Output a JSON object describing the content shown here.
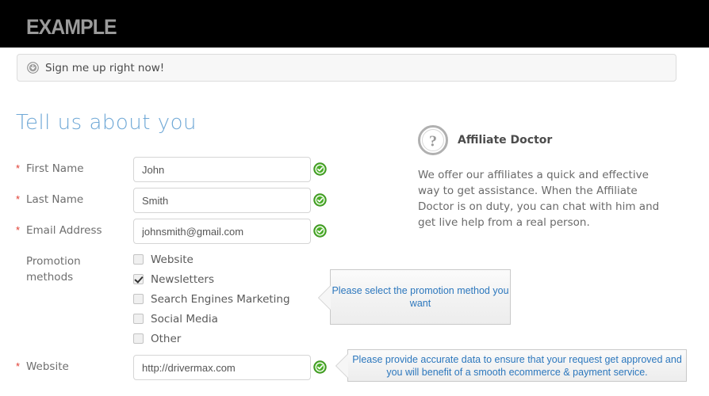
{
  "header": {
    "brand": "EXAMPLE",
    "brand_color": "#9b9b9b",
    "background_color": "#000000"
  },
  "signup_bar": {
    "label": "Sign me up right now!",
    "icon": "arrow-down-circle-icon"
  },
  "section": {
    "title": "Tell us about you",
    "title_color": "#6fa8d6"
  },
  "form": {
    "required_marker": "*",
    "fields": [
      {
        "label": "First Name",
        "value": "John",
        "required": true,
        "valid_icon": "green-check-icon"
      },
      {
        "label": "Last Name",
        "value": "Smith",
        "required": true,
        "valid_icon": "green-check-icon"
      },
      {
        "label": "Email Address",
        "value": "johnsmith@gmail.com",
        "required": true,
        "valid_icon": "green-check-icon"
      }
    ],
    "promotion": {
      "label": "Promotion methods",
      "options": [
        {
          "label": "Website",
          "checked": false
        },
        {
          "label": "Newsletters",
          "checked": true
        },
        {
          "label": "Search Engines Marketing",
          "checked": false
        },
        {
          "label": "Social Media",
          "checked": false
        },
        {
          "label": "Other",
          "checked": false
        }
      ]
    },
    "website": {
      "label": "Website",
      "value": "http://drivermax.com",
      "required": true,
      "valid_icon": "green-check-icon"
    }
  },
  "callouts": {
    "promotion": {
      "text": "Please select the promotion method you want",
      "text_color": "#2c77bd"
    },
    "website": {
      "text": "Please provide accurate data to ensure  that your request get approved and you will benefit of a smooth ecommerce & payment service.",
      "text_color": "#2c77bd"
    }
  },
  "affiliate_doctor": {
    "icon": "question-mark-circle-icon",
    "title": "Affiliate Doctor",
    "body": "We offer our affiliates a quick and effective way to get assistance. When the Affiliate Doctor is on duty, you can chat with him and get live help from a real person."
  }
}
